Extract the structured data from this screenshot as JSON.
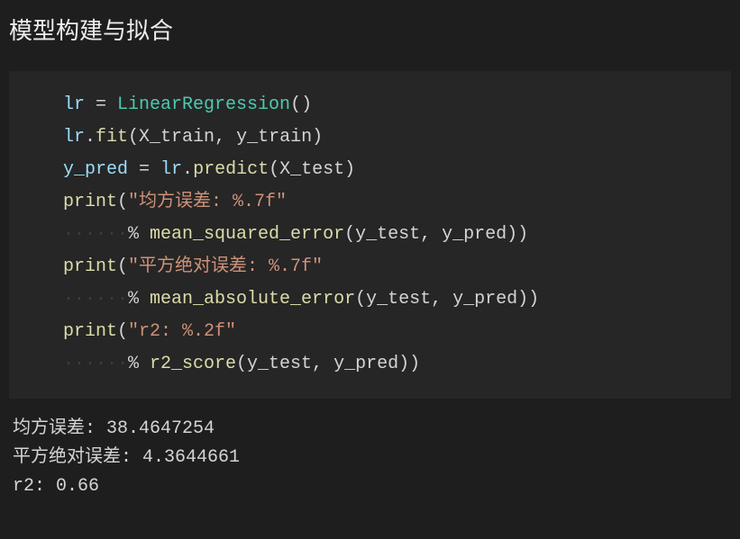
{
  "title": "模型构建与拟合",
  "code": {
    "l1": {
      "v1": "lr",
      "op": " = ",
      "cls": "LinearRegression",
      "p1": "()"
    },
    "l2": {
      "v1": "lr",
      "dot": ".",
      "fn": "fit",
      "p": "(X_train, y_train)"
    },
    "l3": {
      "v1": "y_pred",
      "op": " = ",
      "v2": "lr",
      "dot": ".",
      "fn": "predict",
      "p": "(X_test)"
    },
    "l4": {
      "fn": "print",
      "p1": "(",
      "str": "\"均方误差: %.7f\"",
      "ws": " "
    },
    "l5": {
      "ws": "······",
      "op": "% ",
      "fn": "mean_squared_error",
      "p": "(y_test, y_pred))"
    },
    "l6": {
      "fn": "print",
      "p1": "(",
      "str": "\"平方绝对误差: %.7f\"",
      "ws": " "
    },
    "l7": {
      "ws": "······",
      "op": "% ",
      "fn": "mean_absolute_error",
      "p": "(y_test, y_pred))"
    },
    "l8": {
      "fn": "print",
      "p1": "(",
      "str": "\"r2: %.2f\"",
      "ws": " "
    },
    "l9": {
      "ws": "······",
      "op": "% ",
      "fn": "r2_score",
      "p": "(y_test, y_pred))"
    }
  },
  "output": {
    "l1": "均方误差: 38.4647254",
    "l2": "平方绝对误差: 4.3644661",
    "l3": "r2: 0.66"
  }
}
